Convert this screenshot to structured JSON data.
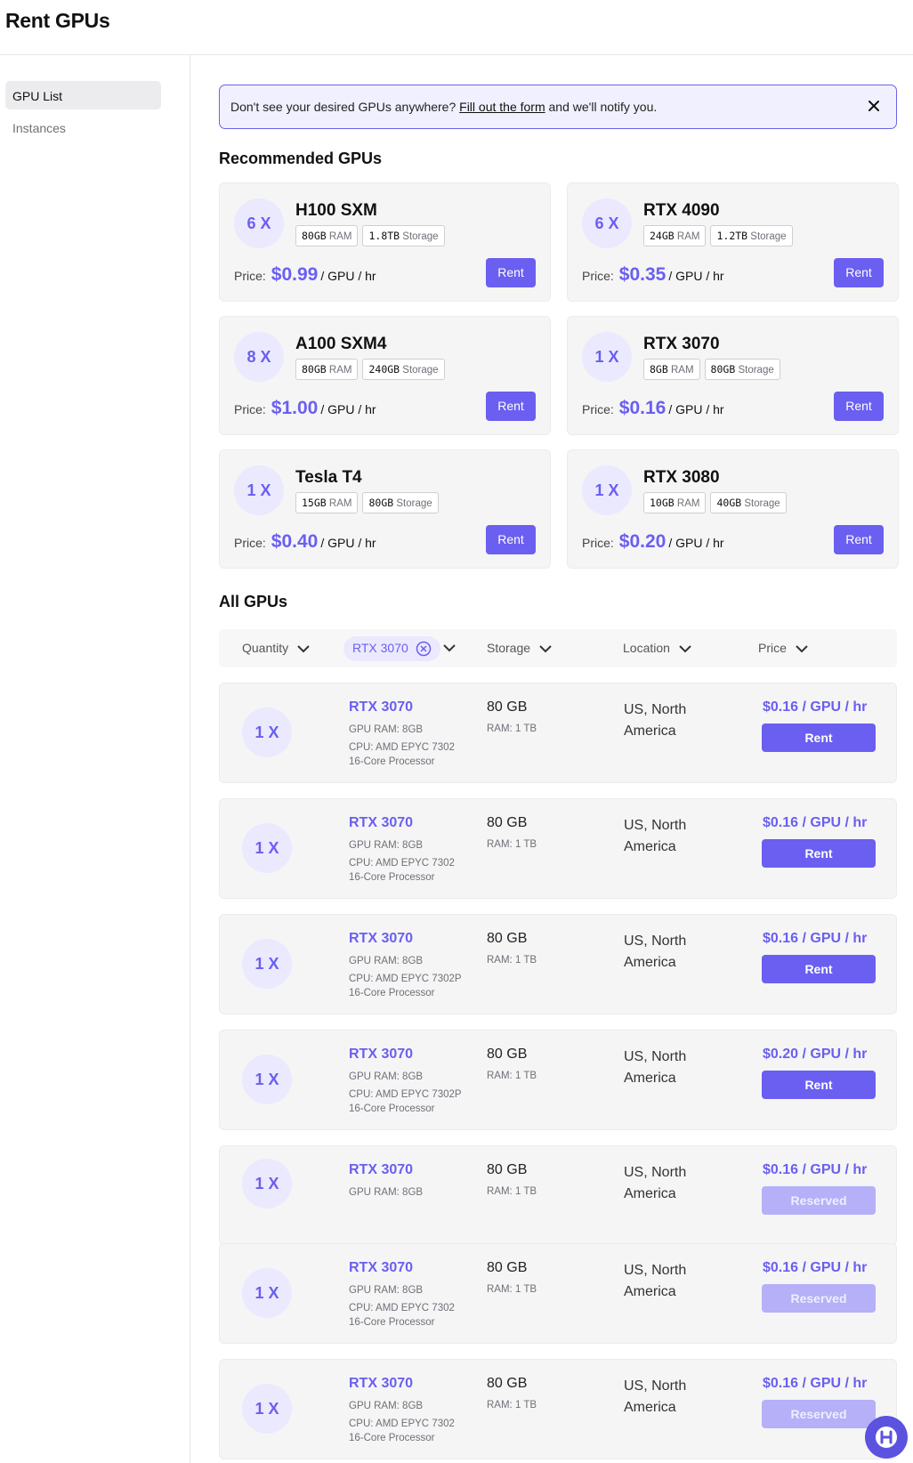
{
  "header": {
    "title": "Rent GPUs"
  },
  "sidebar": {
    "items": [
      {
        "label": "GPU List",
        "active": true
      },
      {
        "label": "Instances",
        "active": false
      }
    ]
  },
  "banner": {
    "text_before": "Don't see your desired GPUs anywhere?",
    "link": "Fill out the form",
    "text_after": "and we'll notify you."
  },
  "recommended": {
    "title": "Recommended GPUs",
    "price_label": "Price:",
    "unit": "/ GPU / hr",
    "ram_unit": "RAM",
    "storage_unit": "Storage",
    "button": "Rent",
    "cards": [
      {
        "qty": "6 X",
        "name": "H100 SXM",
        "ram": "80GB",
        "storage": "1.8TB",
        "price": "$0.99"
      },
      {
        "qty": "6 X",
        "name": "RTX 4090",
        "ram": "24GB",
        "storage": "1.2TB",
        "price": "$0.35"
      },
      {
        "qty": "8 X",
        "name": "A100 SXM4",
        "ram": "80GB",
        "storage": "240GB",
        "price": "$1.00"
      },
      {
        "qty": "1 X",
        "name": "RTX 3070",
        "ram": "8GB",
        "storage": "80GB",
        "price": "$0.16"
      },
      {
        "qty": "1 X",
        "name": "Tesla T4",
        "ram": "15GB",
        "storage": "80GB",
        "price": "$0.40"
      },
      {
        "qty": "1 X",
        "name": "RTX 3080",
        "ram": "10GB",
        "storage": "40GB",
        "price": "$0.20"
      }
    ]
  },
  "all": {
    "title": "All GPUs",
    "filters": {
      "quantity": "Quantity",
      "gpu": "RTX 3070",
      "storage": "Storage",
      "location": "Location",
      "price": "Price"
    },
    "rows": [
      {
        "qty": "1 X",
        "name": "RTX 3070",
        "gpu_ram": "GPU RAM: 8GB",
        "cpu": "CPU: AMD EPYC 7302",
        "cpu2": "16-Core Processor",
        "storage": "80 GB",
        "ram": "RAM: 1 TB",
        "loc1": "US, North",
        "loc2": "America",
        "price": "$0.16 / GPU / hr",
        "button": "Rent",
        "reserved": false
      },
      {
        "qty": "1 X",
        "name": "RTX 3070",
        "gpu_ram": "GPU RAM: 8GB",
        "cpu": "CPU: AMD EPYC 7302",
        "cpu2": "16-Core Processor",
        "storage": "80 GB",
        "ram": "RAM: 1 TB",
        "loc1": "US, North",
        "loc2": "America",
        "price": "$0.16 / GPU / hr",
        "button": "Rent",
        "reserved": false
      },
      {
        "qty": "1 X",
        "name": "RTX 3070",
        "gpu_ram": "GPU RAM: 8GB",
        "cpu": "CPU: AMD EPYC 7302P",
        "cpu2": "16-Core Processor",
        "storage": "80 GB",
        "ram": "RAM: 1 TB",
        "loc1": "US, North",
        "loc2": "America",
        "price": "$0.16 / GPU / hr",
        "button": "Rent",
        "reserved": false
      },
      {
        "qty": "1 X",
        "name": "RTX 3070",
        "gpu_ram": "GPU RAM: 8GB",
        "cpu": "CPU: AMD EPYC 7302P",
        "cpu2": "16-Core Processor",
        "storage": "80 GB",
        "ram": "RAM: 1 TB",
        "loc1": "US, North",
        "loc2": "America",
        "price": "$0.20 / GPU / hr",
        "button": "Rent",
        "reserved": false
      },
      {
        "qty": "1 X",
        "name": "RTX 3070",
        "gpu_ram": "GPU RAM: 8GB",
        "cpu": "",
        "cpu2": "",
        "storage": "80 GB",
        "ram": "RAM: 1 TB",
        "loc1": "US, North",
        "loc2": "America",
        "price": "$0.16 / GPU / hr",
        "button": "Reserved",
        "reserved": true
      },
      {
        "qty": "1 X",
        "name": "RTX 3070",
        "gpu_ram": "GPU RAM: 8GB",
        "cpu": "CPU: AMD EPYC 7302",
        "cpu2": "16-Core Processor",
        "storage": "80 GB",
        "ram": "RAM: 1 TB",
        "loc1": "US, North",
        "loc2": "America",
        "price": "$0.16 / GPU / hr",
        "button": "Reserved",
        "reserved": true
      },
      {
        "qty": "1 X",
        "name": "RTX 3070",
        "gpu_ram": "GPU RAM: 8GB",
        "cpu": "CPU: AMD EPYC 7302",
        "cpu2": "16-Core Processor",
        "storage": "80 GB",
        "ram": "RAM: 1 TB",
        "loc1": "US, North",
        "loc2": "America",
        "price": "$0.16 / GPU / hr",
        "button": "Reserved",
        "reserved": true
      }
    ]
  },
  "colors": {
    "accent": "#6a5ff0",
    "accent_light": "#ebe9fd",
    "reserved": "#b5b0f7",
    "card_bg": "#f5f5f6"
  },
  "icons": {
    "banner_close": "close-icon",
    "help": "help-chat-icon"
  }
}
